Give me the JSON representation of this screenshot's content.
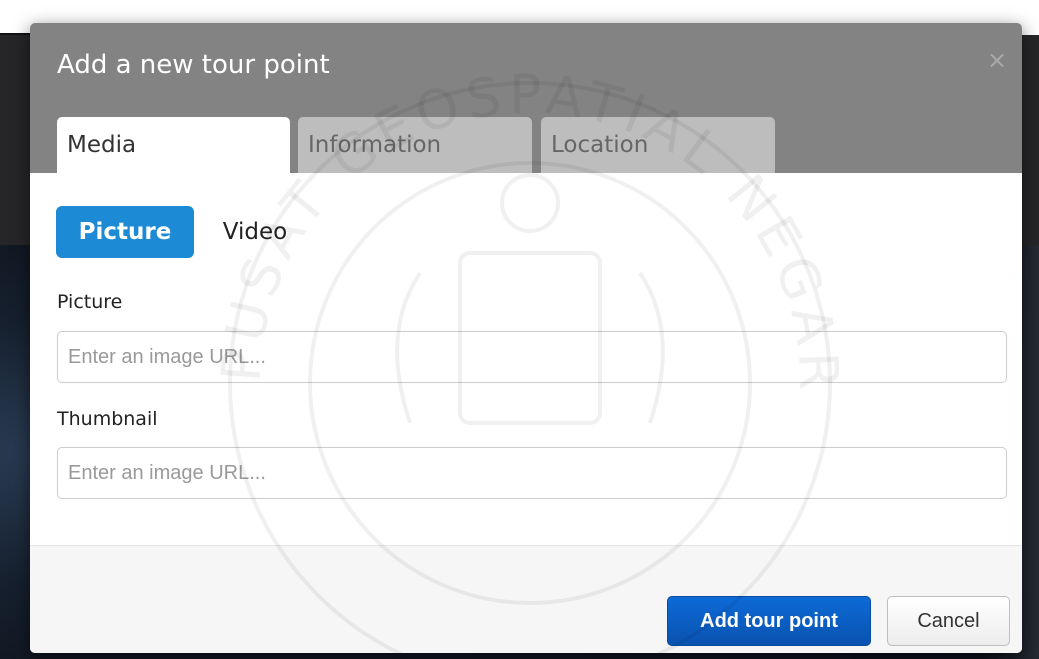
{
  "modal": {
    "title": "Add a new tour point",
    "close_icon": "close-icon"
  },
  "tabs": [
    {
      "label": "Media",
      "active": true
    },
    {
      "label": "Information",
      "active": false
    },
    {
      "label": "Location",
      "active": false
    }
  ],
  "media_type": {
    "options": [
      "Picture",
      "Video"
    ],
    "selected": "Picture"
  },
  "fields": {
    "picture": {
      "label": "Picture",
      "value": "",
      "placeholder": "Enter an image URL..."
    },
    "thumbnail": {
      "label": "Thumbnail",
      "value": "",
      "placeholder": "Enter an image URL..."
    }
  },
  "footer": {
    "primary_label": "Add tour point",
    "cancel_label": "Cancel"
  },
  "watermark": {
    "text": "PUSAT GEOSPATIAL NEGARA"
  },
  "colors": {
    "header_bg": "#838383",
    "accent_blue": "#1d8ad6",
    "primary_button": "#0a5cc2"
  }
}
